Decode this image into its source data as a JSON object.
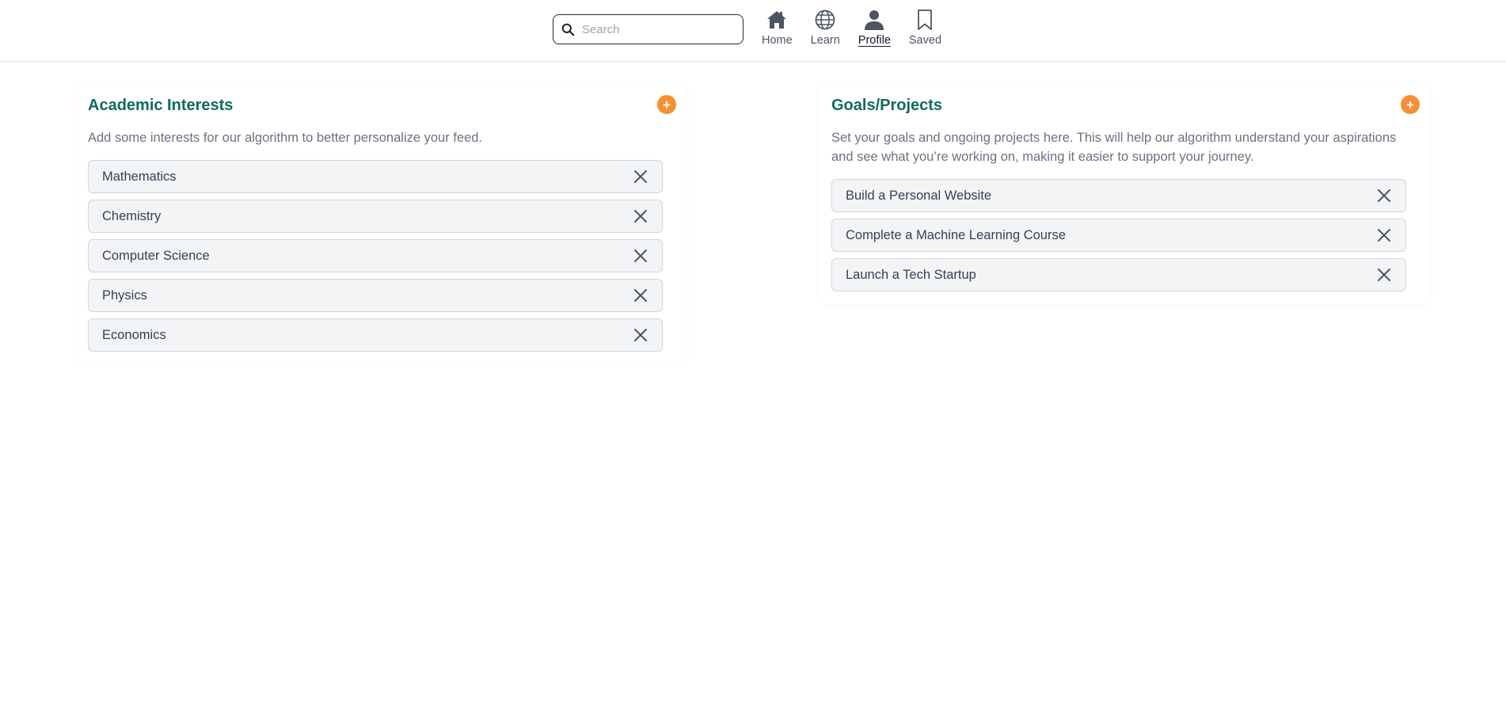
{
  "search": {
    "placeholder": "Search",
    "value": ""
  },
  "nav": [
    {
      "label": "Home",
      "icon": "home-icon"
    },
    {
      "label": "Learn",
      "icon": "globe-icon"
    },
    {
      "label": "Profile",
      "icon": "user-icon",
      "active": true
    },
    {
      "label": "Saved",
      "icon": "bookmark-icon"
    }
  ],
  "interests": {
    "title": "Academic Interests",
    "add_label": "+",
    "description": "Add some interests for our algorithm to better personalize your feed.",
    "items": [
      "Mathematics",
      "Chemistry",
      "Computer Science",
      "Physics",
      "Economics"
    ]
  },
  "goals": {
    "title": "Goals/Projects",
    "add_label": "+",
    "description": "Set your goals and ongoing projects here. This will help our algorithm understand your aspirations and see what you’re working on, making it easier to support your journey.",
    "items": [
      "Build a Personal Website",
      "Complete a Machine Learning Course",
      "Launch a Tech Startup"
    ]
  },
  "colors": {
    "accent_title": "#0f6b5c",
    "add_button": "#f59134",
    "item_bg": "#f3f4f6"
  }
}
